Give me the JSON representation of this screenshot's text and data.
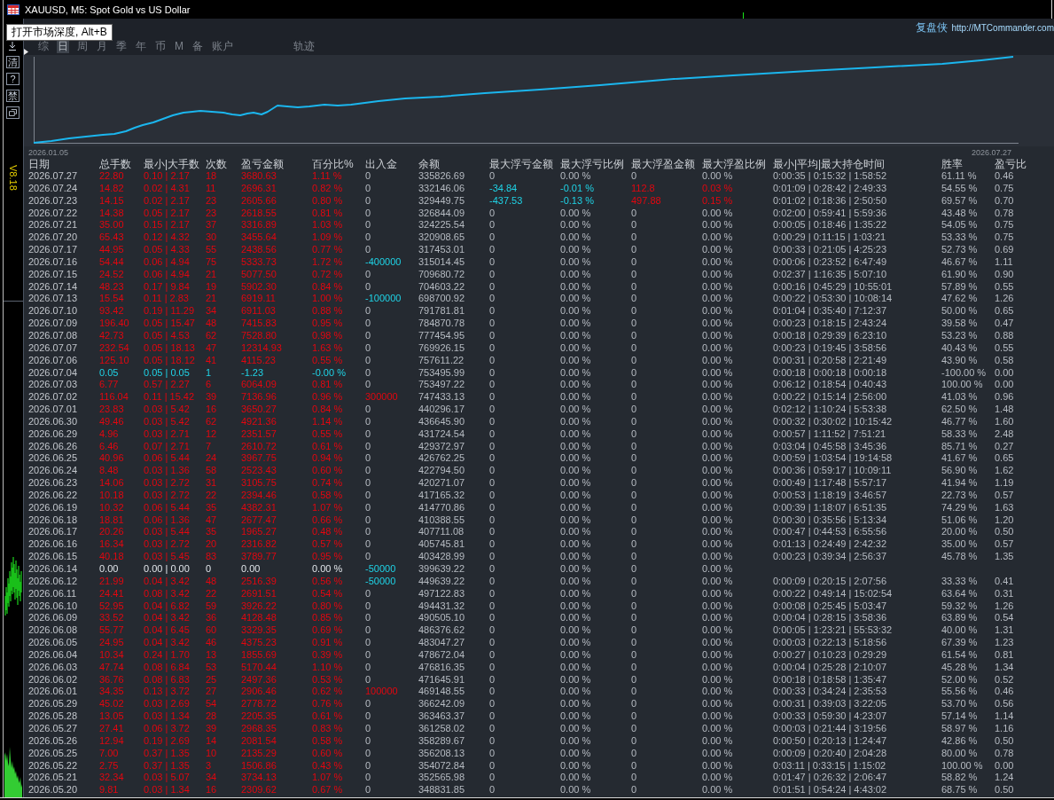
{
  "window": {
    "title": "XAUUSD, M5: Spot Gold vs US Dollar"
  },
  "tooltip": {
    "text": "打开市场深度, Alt+B"
  },
  "side_buttons": [
    "清",
    "?",
    "禁"
  ],
  "version": "V8.18",
  "brand": {
    "name": "复盘侠",
    "url": "http://MTCommander.com"
  },
  "tabs": [
    {
      "label": "综",
      "selected": false
    },
    {
      "label": "日",
      "selected": true
    },
    {
      "label": "周",
      "selected": false
    },
    {
      "label": "月",
      "selected": false
    },
    {
      "label": "季",
      "selected": false
    },
    {
      "label": "年",
      "selected": false
    },
    {
      "label": "币",
      "selected": false
    },
    {
      "label": "M",
      "selected": false
    },
    {
      "label": "备",
      "selected": false
    },
    {
      "label": "账户",
      "selected": false
    },
    {
      "label": "轨迹",
      "selected": false
    }
  ],
  "chart": {
    "start_label": "2026.01.05",
    "end_label": "2026.07.27"
  },
  "table": {
    "columns": [
      "日期",
      "总手数",
      "最小|大手数",
      "次数",
      "盈亏金额",
      "百分比%",
      "出入金",
      "余额",
      "最大浮亏金额",
      "最大浮亏比例",
      "最大浮盈金额",
      "最大浮盈比例",
      "最小|平均|最大持仓时间",
      "胜率",
      "盈亏比"
    ],
    "rows": [
      {
        "cells": [
          "2026.07.27",
          "22.80",
          "0.10 | 2.17",
          "18",
          "3680.63",
          "1.11 %",
          "0",
          "335826.69",
          "0",
          "0.00 %",
          "0",
          "0.00 %",
          "0:00:35 | 0:15:32 | 1:58:52",
          "61.11 %",
          "0.46"
        ],
        "kind": "gain",
        "deposit": false,
        "withdrawal": false,
        "float_loss": false,
        "float_gain": false
      },
      {
        "cells": [
          "2026.07.24",
          "14.82",
          "0.02 | 4.31",
          "11",
          "2696.31",
          "0.82 %",
          "0",
          "332146.06",
          "-34.84",
          "-0.01 %",
          "112.8",
          "0.03 %",
          "0:01:09 | 0:28:42 | 2:49:33",
          "54.55 %",
          "0.75"
        ],
        "kind": "gain",
        "deposit": false,
        "withdrawal": false,
        "float_loss": true,
        "float_gain": true
      },
      {
        "cells": [
          "2026.07.23",
          "14.15",
          "0.02 | 2.17",
          "23",
          "2605.66",
          "0.80 %",
          "0",
          "329449.75",
          "-437.53",
          "-0.13 %",
          "497.88",
          "0.15 %",
          "0:01:02 | 0:18:36 | 2:50:50",
          "69.57 %",
          "0.70"
        ],
        "kind": "gain",
        "deposit": false,
        "withdrawal": false,
        "float_loss": true,
        "float_gain": true
      },
      {
        "cells": [
          "2026.07.22",
          "14.38",
          "0.05 | 2.17",
          "23",
          "2618.55",
          "0.81 %",
          "0",
          "326844.09",
          "0",
          "0.00 %",
          "0",
          "0.00 %",
          "0:02:00 | 0:59:41 | 5:59:36",
          "43.48 %",
          "0.78"
        ],
        "kind": "gain",
        "deposit": false,
        "withdrawal": false,
        "float_loss": false,
        "float_gain": false
      },
      {
        "cells": [
          "2026.07.21",
          "35.00",
          "0.15 | 2.17",
          "37",
          "3316.89",
          "1.03 %",
          "0",
          "324225.54",
          "0",
          "0.00 %",
          "0",
          "0.00 %",
          "0:00:05 | 0:18:46 | 1:35:22",
          "54.05 %",
          "0.75"
        ],
        "kind": "gain",
        "deposit": false,
        "withdrawal": false,
        "float_loss": false,
        "float_gain": false
      },
      {
        "cells": [
          "2026.07.20",
          "65.43",
          "0.12 | 4.32",
          "30",
          "3455.64",
          "1.09 %",
          "0",
          "320908.65",
          "0",
          "0.00 %",
          "0",
          "0.00 %",
          "0:00:29 | 0:11:15 | 1:03:21",
          "53.33 %",
          "0.75"
        ],
        "kind": "gain",
        "deposit": false,
        "withdrawal": false,
        "float_loss": false,
        "float_gain": false
      },
      {
        "cells": [
          "2026.07.17",
          "44.95",
          "0.05 | 4.33",
          "55",
          "2438.56",
          "0.77 %",
          "0",
          "317453.01",
          "0",
          "0.00 %",
          "0",
          "0.00 %",
          "0:00:33 | 0:21:05 | 4:25:23",
          "52.73 %",
          "0.69"
        ],
        "kind": "gain",
        "deposit": false,
        "withdrawal": false,
        "float_loss": false,
        "float_gain": false
      },
      {
        "cells": [
          "2026.07.16",
          "54.44",
          "0.06 | 4.94",
          "75",
          "5333.73",
          "1.72 %",
          "-400000",
          "315014.45",
          "0",
          "0.00 %",
          "0",
          "0.00 %",
          "0:00:06 | 0:23:52 | 6:47:49",
          "46.67 %",
          "1.11"
        ],
        "kind": "gain",
        "deposit": false,
        "withdrawal": true,
        "float_loss": false,
        "float_gain": false
      },
      {
        "cells": [
          "2026.07.15",
          "24.52",
          "0.06 | 4.94",
          "21",
          "5077.50",
          "0.72 %",
          "0",
          "709680.72",
          "0",
          "0.00 %",
          "0",
          "0.00 %",
          "0:02:37 | 1:16:35 | 5:07:10",
          "61.90 %",
          "0.90"
        ],
        "kind": "gain",
        "deposit": false,
        "withdrawal": false,
        "float_loss": false,
        "float_gain": false
      },
      {
        "cells": [
          "2026.07.14",
          "48.23",
          "0.17 | 9.84",
          "19",
          "5902.30",
          "0.84 %",
          "0",
          "704603.22",
          "0",
          "0.00 %",
          "0",
          "0.00 %",
          "0:00:16 | 0:45:29 | 10:55:01",
          "57.89 %",
          "0.55"
        ],
        "kind": "gain",
        "deposit": false,
        "withdrawal": false,
        "float_loss": false,
        "float_gain": false
      },
      {
        "cells": [
          "2026.07.13",
          "15.54",
          "0.11 | 2.83",
          "21",
          "6919.11",
          "1.00 %",
          "-100000",
          "698700.92",
          "0",
          "0.00 %",
          "0",
          "0.00 %",
          "0:00:22 | 0:53:30 | 10:08:14",
          "47.62 %",
          "1.26"
        ],
        "kind": "gain",
        "deposit": false,
        "withdrawal": true,
        "float_loss": false,
        "float_gain": false
      },
      {
        "cells": [
          "2026.07.10",
          "93.42",
          "0.19 | 11.29",
          "34",
          "6911.03",
          "0.88 %",
          "0",
          "791781.81",
          "0",
          "0.00 %",
          "0",
          "0.00 %",
          "0:01:04 | 0:35:40 | 7:12:37",
          "50.00 %",
          "0.65"
        ],
        "kind": "gain",
        "deposit": false,
        "withdrawal": false,
        "float_loss": false,
        "float_gain": false
      },
      {
        "cells": [
          "2026.07.09",
          "196.40",
          "0.05 | 15.47",
          "48",
          "7415.83",
          "0.95 %",
          "0",
          "784870.78",
          "0",
          "0.00 %",
          "0",
          "0.00 %",
          "0:00:23 | 0:18:15 | 2:43:24",
          "39.58 %",
          "0.47"
        ],
        "kind": "gain",
        "deposit": false,
        "withdrawal": false,
        "float_loss": false,
        "float_gain": false
      },
      {
        "cells": [
          "2026.07.08",
          "42.73",
          "0.05 | 4.53",
          "62",
          "7528.80",
          "0.98 %",
          "0",
          "777454.95",
          "0",
          "0.00 %",
          "0",
          "0.00 %",
          "0:00:18 | 0:29:39 | 6:23:10",
          "53.23 %",
          "0.88"
        ],
        "kind": "gain",
        "deposit": false,
        "withdrawal": false,
        "float_loss": false,
        "float_gain": false
      },
      {
        "cells": [
          "2026.07.07",
          "232.54",
          "0.05 | 18.13",
          "47",
          "12314.93",
          "1.63 %",
          "0",
          "769926.15",
          "0",
          "0.00 %",
          "0",
          "0.00 %",
          "0:00:23 | 0:19:45 | 3:58:56",
          "40.43 %",
          "0.55"
        ],
        "kind": "gain",
        "deposit": false,
        "withdrawal": false,
        "float_loss": false,
        "float_gain": false
      },
      {
        "cells": [
          "2026.07.06",
          "125.10",
          "0.05 | 18.12",
          "41",
          "4115.23",
          "0.55 %",
          "0",
          "757611.22",
          "0",
          "0.00 %",
          "0",
          "0.00 %",
          "0:00:31 | 0:20:58 | 2:21:49",
          "43.90 %",
          "0.58"
        ],
        "kind": "gain",
        "deposit": false,
        "withdrawal": false,
        "float_loss": false,
        "float_gain": false
      },
      {
        "cells": [
          "2026.07.04",
          "0.05",
          "0.05 | 0.05",
          "1",
          "-1.23",
          "-0.00 %",
          "0",
          "753495.99",
          "0",
          "0.00 %",
          "0",
          "0.00 %",
          "0:00:18 | 0:00:18 | 0:00:18",
          "-100.00 %",
          "0.00"
        ],
        "kind": "loss",
        "deposit": false,
        "withdrawal": false,
        "float_loss": false,
        "float_gain": false
      },
      {
        "cells": [
          "2026.07.03",
          "6.77",
          "0.57 | 2.27",
          "6",
          "6064.09",
          "0.81 %",
          "0",
          "753497.22",
          "0",
          "0.00 %",
          "0",
          "0.00 %",
          "0:06:12 | 0:18:54 | 0:40:43",
          "100.00 %",
          "0.00"
        ],
        "kind": "gain",
        "deposit": false,
        "withdrawal": false,
        "float_loss": false,
        "float_gain": false
      },
      {
        "cells": [
          "2026.07.02",
          "116.04",
          "0.11 | 15.42",
          "39",
          "7136.96",
          "0.96 %",
          "300000",
          "747433.13",
          "0",
          "0.00 %",
          "0",
          "0.00 %",
          "0:00:22 | 0:15:14 | 2:56:00",
          "41.03 %",
          "0.96"
        ],
        "kind": "gain",
        "deposit": true,
        "withdrawal": false,
        "float_loss": false,
        "float_gain": false
      },
      {
        "cells": [
          "2026.07.01",
          "23.83",
          "0.03 | 5.42",
          "16",
          "3650.27",
          "0.84 %",
          "0",
          "440296.17",
          "0",
          "0.00 %",
          "0",
          "0.00 %",
          "0:02:12 | 1:10:24 | 5:53:38",
          "62.50 %",
          "1.48"
        ],
        "kind": "gain",
        "deposit": false,
        "withdrawal": false,
        "float_loss": false,
        "float_gain": false
      },
      {
        "cells": [
          "2026.06.30",
          "49.46",
          "0.03 | 5.42",
          "62",
          "4921.36",
          "1.14 %",
          "0",
          "436645.90",
          "0",
          "0.00 %",
          "0",
          "0.00 %",
          "0:00:32 | 0:30:02 | 10:15:42",
          "46.77 %",
          "1.60"
        ],
        "kind": "gain",
        "deposit": false,
        "withdrawal": false,
        "float_loss": false,
        "float_gain": false
      },
      {
        "cells": [
          "2026.06.29",
          "4.96",
          "0.03 | 2.71",
          "12",
          "2351.57",
          "0.55 %",
          "0",
          "431724.54",
          "0",
          "0.00 %",
          "0",
          "0.00 %",
          "0:00:57 | 1:11:52 | 7:51:21",
          "58.33 %",
          "2.48"
        ],
        "kind": "gain",
        "deposit": false,
        "withdrawal": false,
        "float_loss": false,
        "float_gain": false
      },
      {
        "cells": [
          "2026.06.26",
          "6.46",
          "0.07 | 2.71",
          "7",
          "2610.72",
          "0.61 %",
          "0",
          "429372.97",
          "0",
          "0.00 %",
          "0",
          "0.00 %",
          "0:03:04 | 0:45:58 | 3:45:36",
          "85.71 %",
          "0.27"
        ],
        "kind": "gain",
        "deposit": false,
        "withdrawal": false,
        "float_loss": false,
        "float_gain": false
      },
      {
        "cells": [
          "2026.06.25",
          "40.96",
          "0.06 | 5.44",
          "24",
          "3967.75",
          "0.94 %",
          "0",
          "426762.25",
          "0",
          "0.00 %",
          "0",
          "0.00 %",
          "0:00:59 | 1:03:54 | 19:14:58",
          "41.67 %",
          "0.65"
        ],
        "kind": "gain",
        "deposit": false,
        "withdrawal": false,
        "float_loss": false,
        "float_gain": false
      },
      {
        "cells": [
          "2026.06.24",
          "8.48",
          "0.03 | 1.36",
          "58",
          "2523.43",
          "0.60 %",
          "0",
          "422794.50",
          "0",
          "0.00 %",
          "0",
          "0.00 %",
          "0:00:36 | 0:59:17 | 10:09:11",
          "56.90 %",
          "1.62"
        ],
        "kind": "gain",
        "deposit": false,
        "withdrawal": false,
        "float_loss": false,
        "float_gain": false
      },
      {
        "cells": [
          "2026.06.23",
          "14.06",
          "0.03 | 2.72",
          "31",
          "3105.75",
          "0.74 %",
          "0",
          "420271.07",
          "0",
          "0.00 %",
          "0",
          "0.00 %",
          "0:00:49 | 1:17:48 | 5:57:17",
          "41.94 %",
          "1.19"
        ],
        "kind": "gain",
        "deposit": false,
        "withdrawal": false,
        "float_loss": false,
        "float_gain": false
      },
      {
        "cells": [
          "2026.06.22",
          "10.18",
          "0.03 | 2.72",
          "22",
          "2394.46",
          "0.58 %",
          "0",
          "417165.32",
          "0",
          "0.00 %",
          "0",
          "0.00 %",
          "0:00:53 | 1:18:19 | 3:46:57",
          "22.73 %",
          "0.57"
        ],
        "kind": "gain",
        "deposit": false,
        "withdrawal": false,
        "float_loss": false,
        "float_gain": false
      },
      {
        "cells": [
          "2026.06.19",
          "10.32",
          "0.06 | 5.44",
          "35",
          "4382.31",
          "1.07 %",
          "0",
          "414770.86",
          "0",
          "0.00 %",
          "0",
          "0.00 %",
          "0:00:39 | 1:18:07 | 6:51:35",
          "74.29 %",
          "1.63"
        ],
        "kind": "gain",
        "deposit": false,
        "withdrawal": false,
        "float_loss": false,
        "float_gain": false
      },
      {
        "cells": [
          "2026.06.18",
          "18.81",
          "0.06 | 1.36",
          "47",
          "2677.47",
          "0.66 %",
          "0",
          "410388.55",
          "0",
          "0.00 %",
          "0",
          "0.00 %",
          "0:00:30 | 0:35:56 | 5:13:34",
          "51.06 %",
          "1.20"
        ],
        "kind": "gain",
        "deposit": false,
        "withdrawal": false,
        "float_loss": false,
        "float_gain": false
      },
      {
        "cells": [
          "2026.06.17",
          "20.26",
          "0.03 | 5.44",
          "35",
          "1965.27",
          "0.48 %",
          "0",
          "407711.08",
          "0",
          "0.00 %",
          "0",
          "0.00 %",
          "0:00:47 | 0:44:53 | 6:55:56",
          "20.00 %",
          "0.50"
        ],
        "kind": "gain",
        "deposit": false,
        "withdrawal": false,
        "float_loss": false,
        "float_gain": false
      },
      {
        "cells": [
          "2026.06.16",
          "16.34",
          "0.03 | 2.72",
          "20",
          "2316.82",
          "0.57 %",
          "0",
          "405745.81",
          "0",
          "0.00 %",
          "0",
          "0.00 %",
          "0:01:13 | 0:24:49 | 2:42:32",
          "35.00 %",
          "0.57"
        ],
        "kind": "gain",
        "deposit": false,
        "withdrawal": false,
        "float_loss": false,
        "float_gain": false
      },
      {
        "cells": [
          "2026.06.15",
          "40.18",
          "0.03 | 5.45",
          "83",
          "3789.77",
          "0.95 %",
          "0",
          "403428.99",
          "0",
          "0.00 %",
          "0",
          "0.00 %",
          "0:00:23 | 0:39:34 | 2:56:37",
          "45.78 %",
          "1.35"
        ],
        "kind": "gain",
        "deposit": false,
        "withdrawal": false,
        "float_loss": false,
        "float_gain": false
      },
      {
        "cells": [
          "2026.06.14",
          "0.00",
          "0.00 | 0.00",
          "0",
          "0.00",
          "0.00 %",
          "-50000",
          "399639.22",
          "0",
          "0.00 %",
          "0",
          "0.00 %"
        ],
        "kind": "flat",
        "deposit": false,
        "withdrawal": true,
        "float_loss": false,
        "float_gain": false
      },
      {
        "cells": [
          "2026.06.12",
          "21.99",
          "0.04 | 3.42",
          "48",
          "2516.39",
          "0.56 %",
          "-50000",
          "449639.22",
          "0",
          "0.00 %",
          "0",
          "0.00 %",
          "0:00:09 | 0:20:15 | 2:07:56",
          "33.33 %",
          "0.41"
        ],
        "kind": "gain",
        "deposit": false,
        "withdrawal": true,
        "float_loss": false,
        "float_gain": false
      },
      {
        "cells": [
          "2026.06.11",
          "24.41",
          "0.08 | 3.42",
          "22",
          "2691.51",
          "0.54 %",
          "0",
          "497122.83",
          "0",
          "0.00 %",
          "0",
          "0.00 %",
          "0:00:22 | 0:49:14 | 15:02:54",
          "63.64 %",
          "0.31"
        ],
        "kind": "gain",
        "deposit": false,
        "withdrawal": false,
        "float_loss": false,
        "float_gain": false
      },
      {
        "cells": [
          "2026.06.10",
          "52.95",
          "0.04 | 6.82",
          "59",
          "3926.22",
          "0.80 %",
          "0",
          "494431.32",
          "0",
          "0.00 %",
          "0",
          "0.00 %",
          "0:00:08 | 0:25:45 | 5:03:47",
          "59.32 %",
          "1.26"
        ],
        "kind": "gain",
        "deposit": false,
        "withdrawal": false,
        "float_loss": false,
        "float_gain": false
      },
      {
        "cells": [
          "2026.06.09",
          "33.52",
          "0.04 | 3.42",
          "36",
          "4128.48",
          "0.85 %",
          "0",
          "490505.10",
          "0",
          "0.00 %",
          "0",
          "0.00 %",
          "0:00:04 | 0:28:15 | 3:58:36",
          "63.89 %",
          "0.54"
        ],
        "kind": "gain",
        "deposit": false,
        "withdrawal": false,
        "float_loss": false,
        "float_gain": false
      },
      {
        "cells": [
          "2026.06.08",
          "55.77",
          "0.04 | 6.45",
          "60",
          "3329.35",
          "0.69 %",
          "0",
          "486376.62",
          "0",
          "0.00 %",
          "0",
          "0.00 %",
          "0:00:05 | 1:23:21 | 55:53:32",
          "40.00 %",
          "1.31"
        ],
        "kind": "gain",
        "deposit": false,
        "withdrawal": false,
        "float_loss": false,
        "float_gain": false
      },
      {
        "cells": [
          "2026.06.05",
          "24.95",
          "0.04 | 3.42",
          "46",
          "4375.23",
          "0.91 %",
          "0",
          "483047.27",
          "0",
          "0.00 %",
          "0",
          "0.00 %",
          "0:00:03 | 0:22:13 | 5:18:56",
          "67.39 %",
          "1.23"
        ],
        "kind": "gain",
        "deposit": false,
        "withdrawal": false,
        "float_loss": false,
        "float_gain": false
      },
      {
        "cells": [
          "2026.06.04",
          "10.34",
          "0.24 | 1.70",
          "13",
          "1855.69",
          "0.39 %",
          "0",
          "478672.04",
          "0",
          "0.00 %",
          "0",
          "0.00 %",
          "0:00:27 | 0:10:23 | 0:29:29",
          "61.54 %",
          "0.81"
        ],
        "kind": "gain",
        "deposit": false,
        "withdrawal": false,
        "float_loss": false,
        "float_gain": false
      },
      {
        "cells": [
          "2026.06.03",
          "47.74",
          "0.08 | 6.84",
          "53",
          "5170.44",
          "1.10 %",
          "0",
          "476816.35",
          "0",
          "0.00 %",
          "0",
          "0.00 %",
          "0:00:04 | 0:25:28 | 2:10:07",
          "45.28 %",
          "1.34"
        ],
        "kind": "gain",
        "deposit": false,
        "withdrawal": false,
        "float_loss": false,
        "float_gain": false
      },
      {
        "cells": [
          "2026.06.02",
          "36.76",
          "0.08 | 6.83",
          "25",
          "2497.36",
          "0.53 %",
          "0",
          "471645.91",
          "0",
          "0.00 %",
          "0",
          "0.00 %",
          "0:00:18 | 0:18:58 | 1:35:47",
          "52.00 %",
          "0.52"
        ],
        "kind": "gain",
        "deposit": false,
        "withdrawal": false,
        "float_loss": false,
        "float_gain": false
      },
      {
        "cells": [
          "2026.06.01",
          "34.35",
          "0.13 | 3.72",
          "27",
          "2906.46",
          "0.62 %",
          "100000",
          "469148.55",
          "0",
          "0.00 %",
          "0",
          "0.00 %",
          "0:00:33 | 0:34:24 | 2:35:53",
          "55.56 %",
          "0.46"
        ],
        "kind": "gain",
        "deposit": true,
        "withdrawal": false,
        "float_loss": false,
        "float_gain": false
      },
      {
        "cells": [
          "2026.05.29",
          "45.02",
          "0.03 | 2.69",
          "54",
          "2778.72",
          "0.76 %",
          "0",
          "366242.09",
          "0",
          "0.00 %",
          "0",
          "0.00 %",
          "0:00:31 | 0:39:03 | 3:22:05",
          "53.70 %",
          "0.56"
        ],
        "kind": "gain",
        "deposit": false,
        "withdrawal": false,
        "float_loss": false,
        "float_gain": false
      },
      {
        "cells": [
          "2026.05.28",
          "13.05",
          "0.03 | 1.34",
          "28",
          "2205.35",
          "0.61 %",
          "0",
          "363463.37",
          "0",
          "0.00 %",
          "0",
          "0.00 %",
          "0:00:33 | 0:59:30 | 4:23:07",
          "57.14 %",
          "1.14"
        ],
        "kind": "gain",
        "deposit": false,
        "withdrawal": false,
        "float_loss": false,
        "float_gain": false
      },
      {
        "cells": [
          "2026.05.27",
          "27.41",
          "0.06 | 3.72",
          "39",
          "2968.35",
          "0.83 %",
          "0",
          "361258.02",
          "0",
          "0.00 %",
          "0",
          "0.00 %",
          "0:00:03 | 0:21:44 | 3:19:56",
          "58.97 %",
          "1.16"
        ],
        "kind": "gain",
        "deposit": false,
        "withdrawal": false,
        "float_loss": false,
        "float_gain": false
      },
      {
        "cells": [
          "2026.05.26",
          "12.94",
          "0.19 | 2.69",
          "14",
          "2081.54",
          "0.58 %",
          "0",
          "358289.67",
          "0",
          "0.00 %",
          "0",
          "0.00 %",
          "0:00:50 | 0:20:13 | 1:24:47",
          "42.86 %",
          "0.50"
        ],
        "kind": "gain",
        "deposit": false,
        "withdrawal": false,
        "float_loss": false,
        "float_gain": false
      },
      {
        "cells": [
          "2026.05.25",
          "7.00",
          "0.37 | 1.35",
          "10",
          "2135.29",
          "0.60 %",
          "0",
          "356208.13",
          "0",
          "0.00 %",
          "0",
          "0.00 %",
          "0:00:09 | 0:20:40 | 2:04:28",
          "80.00 %",
          "0.78"
        ],
        "kind": "gain",
        "deposit": false,
        "withdrawal": false,
        "float_loss": false,
        "float_gain": false
      },
      {
        "cells": [
          "2026.05.22",
          "2.75",
          "0.37 | 1.35",
          "3",
          "1506.86",
          "0.43 %",
          "0",
          "354072.84",
          "0",
          "0.00 %",
          "0",
          "0.00 %",
          "0:03:11 | 0:33:15 | 1:15:02",
          "100.00 %",
          "0.00"
        ],
        "kind": "gain",
        "deposit": false,
        "withdrawal": false,
        "float_loss": false,
        "float_gain": false
      },
      {
        "cells": [
          "2026.05.21",
          "32.34",
          "0.03 | 5.07",
          "34",
          "3734.13",
          "1.07 %",
          "0",
          "352565.98",
          "0",
          "0.00 %",
          "0",
          "0.00 %",
          "0:01:47 | 0:26:32 | 2:06:47",
          "58.82 %",
          "1.24"
        ],
        "kind": "gain",
        "deposit": false,
        "withdrawal": false,
        "float_loss": false,
        "float_gain": false
      },
      {
        "cells": [
          "2026.05.20",
          "9.81",
          "0.03 | 1.34",
          "16",
          "2309.62",
          "0.67 %",
          "0",
          "348831.85",
          "0",
          "0.00 %",
          "0",
          "0.00 %",
          "0:01:51 | 0:54:24 | 4:43:02",
          "68.75 %",
          "0.50"
        ],
        "kind": "gain",
        "deposit": false,
        "withdrawal": false,
        "float_loss": false,
        "float_gain": false
      }
    ]
  }
}
